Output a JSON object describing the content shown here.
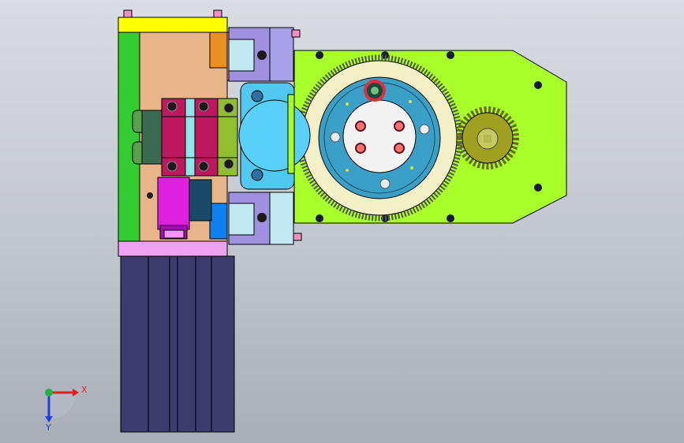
{
  "triad": {
    "x_label": "X",
    "y_label": "Y",
    "x_color": "#e02020",
    "y_color": "#2040e0",
    "origin_color": "#22b04a"
  },
  "colors": {
    "background_top": "#d9dce2",
    "background_bottom": "#a9adb6",
    "side_bar_green": "#33cc33",
    "top_bar_yellow": "#ffff00",
    "base_plate_tan": "#e8b48a",
    "lime_plate": "#a8ff2a",
    "gear_cream": "#f3f0c8",
    "hub_blue": "#3aa0c8",
    "crimson_block": "#c01860",
    "magenta_block": "#e020e0",
    "motor_navy": "#3d3c6e",
    "rail_lavender": "#a090e0",
    "coupling_cyan": "#50c8f0",
    "pinion_olive": "#a0a020",
    "orange_tab": "#e89020",
    "blue_tab": "#1080f0",
    "pink_strip": "#f0a0f0"
  }
}
